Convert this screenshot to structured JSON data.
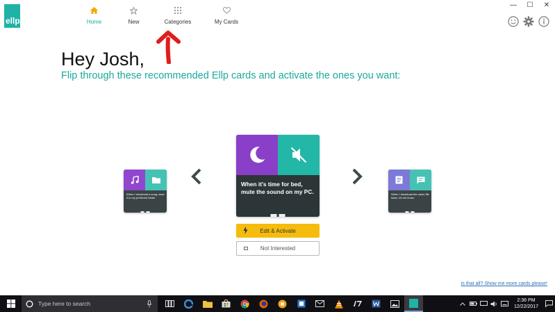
{
  "app": {
    "logo_text": "ellp",
    "window_controls": {
      "minimize": "—",
      "maximize": "☐",
      "close": "✕"
    }
  },
  "nav": {
    "items": [
      {
        "label": "Home",
        "icon": "home-icon",
        "active": true
      },
      {
        "label": "New",
        "icon": "star-icon",
        "active": false
      },
      {
        "label": "Categories",
        "icon": "grid-icon",
        "active": false
      },
      {
        "label": "My Cards",
        "icon": "heart-icon",
        "active": false
      }
    ]
  },
  "header_icons": [
    "smiley-icon",
    "gear-icon",
    "info-icon"
  ],
  "main": {
    "greeting": "Hey Josh,",
    "subtitle": "Flip through these recommended Ellp cards and activate the ones you want:"
  },
  "cards": {
    "left": {
      "text": "When I download a song, save it to my preferred folder.",
      "icons": [
        "music-icon",
        "folder-icon"
      ]
    },
    "center": {
      "text": "When it's time for bed, mute the sound on my PC.",
      "icons": [
        "moon-icon",
        "mute-icon"
      ]
    },
    "right": {
      "text": "When I download the same file twice, let me know.",
      "icons": [
        "document-icon",
        "chat-icon"
      ]
    }
  },
  "buttons": {
    "activate": "Edit & Activate",
    "not_interested": "Not Interested"
  },
  "footer_link": "Is that all? Show me more cards please!",
  "taskbar": {
    "search_placeholder": "Type here to search",
    "time": "2:36 PM",
    "date": "12/22/2017"
  },
  "colors": {
    "accent": "#1aa99d",
    "purple": "#8a3fc8",
    "teal": "#22b7a6",
    "card_dark": "#2c3638",
    "activate": "#f5bc0e"
  }
}
